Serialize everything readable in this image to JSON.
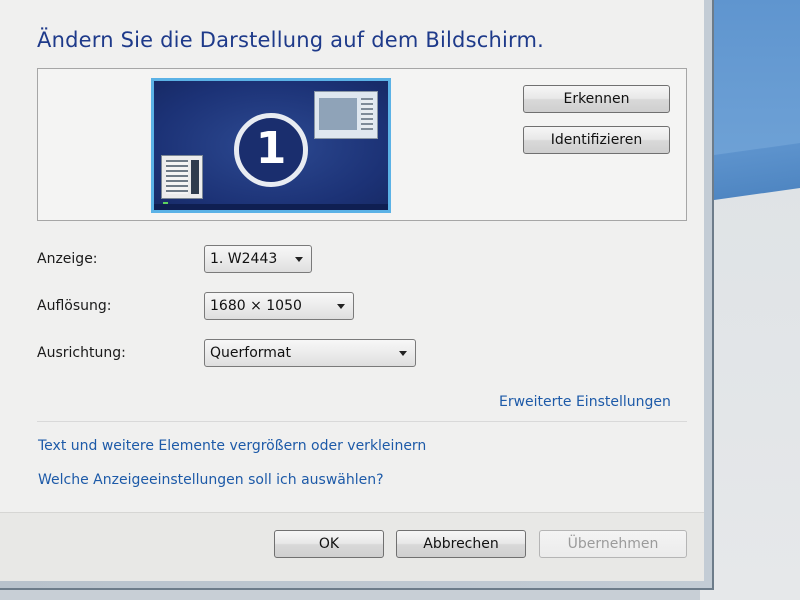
{
  "title": "Ändern Sie die Darstellung auf dem Bildschirm.",
  "preview": {
    "monitor_number": "1",
    "detect_button": "Erkennen",
    "identify_button": "Identifizieren"
  },
  "fields": {
    "display_label": "Anzeige:",
    "display_value": "1. W2443",
    "resolution_label": "Auflösung:",
    "resolution_value": "1680 × 1050",
    "orientation_label": "Ausrichtung:",
    "orientation_value": "Querformat"
  },
  "links": {
    "advanced": "Erweiterte Einstellungen",
    "text_size": "Text und weitere Elemente vergrößern oder verkleinern",
    "which_settings": "Welche Anzeigeeinstellungen soll ich auswählen?"
  },
  "footer": {
    "ok": "OK",
    "cancel": "Abbrechen",
    "apply": "Übernehmen"
  },
  "colors": {
    "title": "#1e3a8a",
    "link": "#1d5aa8",
    "monitor_fill": "#1c3276",
    "monitor_border": "#5bb2e6"
  },
  "icons": {
    "monitor_preview": "display-monitor-icon",
    "dropdown": "chevron-down-icon"
  }
}
